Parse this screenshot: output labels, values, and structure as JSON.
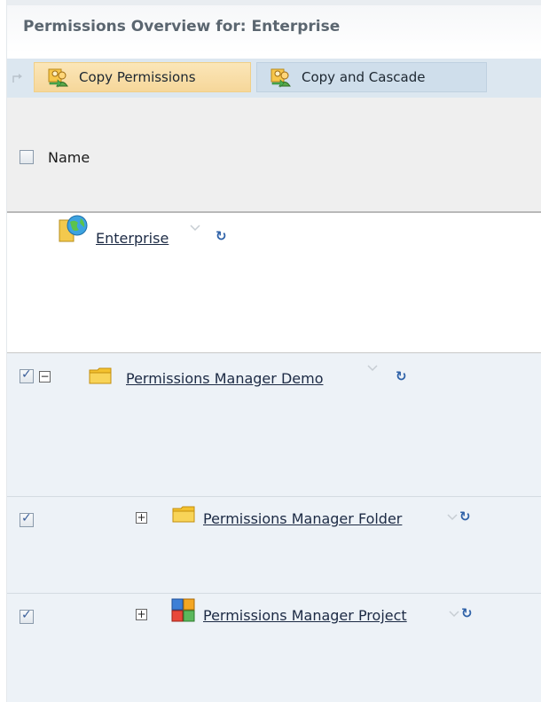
{
  "title": "Permissions Overview for: Enterprise",
  "toolbar": {
    "copy_label": "Copy Permissions",
    "cascade_label": "Copy and Cascade"
  },
  "header": {
    "name_label": "Name"
  },
  "rows": [
    {
      "label": "Enterprise",
      "icon": "enterprise-icon",
      "checked": false
    },
    {
      "label": "Permissions Manager Demo",
      "icon": "folder-icon",
      "checked": true,
      "expander": "minus"
    },
    {
      "label": "Permissions Manager Folder",
      "icon": "folder-icon",
      "checked": true,
      "expander": "plus"
    },
    {
      "label": "Permissions Manager Project",
      "icon": "project-icon",
      "checked": true,
      "expander": "plus"
    }
  ],
  "colors": {
    "toolbar_bg": "#dce7f0",
    "copy_button_bg": "#f6d79a",
    "row_bg": "#edf2f7",
    "title_color": "#5b6670",
    "refresh_color": "#2f62a8"
  }
}
